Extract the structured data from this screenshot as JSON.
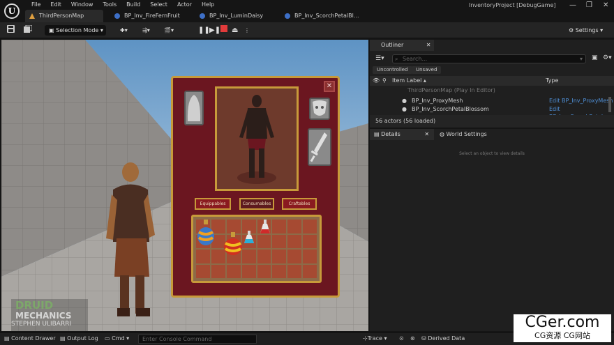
{
  "menu": [
    "File",
    "Edit",
    "Window",
    "Tools",
    "Build",
    "Select",
    "Actor",
    "Help"
  ],
  "tabs": [
    {
      "label": "ThirdPersonMap",
      "active": true
    },
    {
      "label": "BP_Inv_FireFernFruit",
      "active": false
    },
    {
      "label": "BP_Inv_LuminDaisy",
      "active": false
    },
    {
      "label": "BP_Inv_ScorchPetalBl...",
      "active": false
    }
  ],
  "project": "InventoryProject [DebugGame]",
  "toolbar": {
    "selection_mode": "Selection Mode",
    "settings": "Settings"
  },
  "inventory": {
    "buttons": [
      "Equippables",
      "Consumables",
      "Craftables"
    ],
    "active_button": "Consumables",
    "close": "✕",
    "grid_rows": 4,
    "grid_cols": 8
  },
  "outliner": {
    "tab": "Outliner",
    "search_placeholder": "Search...",
    "filters": [
      "Uncontrolled",
      "Unsaved"
    ],
    "col_label": "Item Label",
    "col_type": "Type",
    "rows": [
      {
        "label": "ThirdPersonMap (Play In Editor)",
        "type": ""
      },
      {
        "label": "BP_Inv_ProxyMesh",
        "type": "Edit BP_Inv_ProxyMesh"
      },
      {
        "label": "BP_Inv_ScorchPetalBlossom",
        "type": "Edit BP_Inv_ScorchPetal"
      }
    ],
    "count": "56 actors (56 loaded)"
  },
  "details": {
    "tab": "Details",
    "world_tab": "World Settings",
    "empty": "Select an object to view details"
  },
  "bottom": {
    "content_drawer": "Content Drawer",
    "output_log": "Output Log",
    "cmd": "Cmd",
    "console_placeholder": "Enter Console Command",
    "trace": "Trace",
    "derived": "Derived Data"
  },
  "watermark": {
    "brand1": "DRUID",
    "brand2": "MECHANICS",
    "author": "STEPHEN ULIBARRI"
  },
  "credit": {
    "line1": "CGer.com",
    "line2": "CG资源 CG网站"
  },
  "colors": {
    "accent": "#c79a3a",
    "panel": "#6b1620",
    "link": "#4f8fd6",
    "record": "#e23b3b"
  }
}
